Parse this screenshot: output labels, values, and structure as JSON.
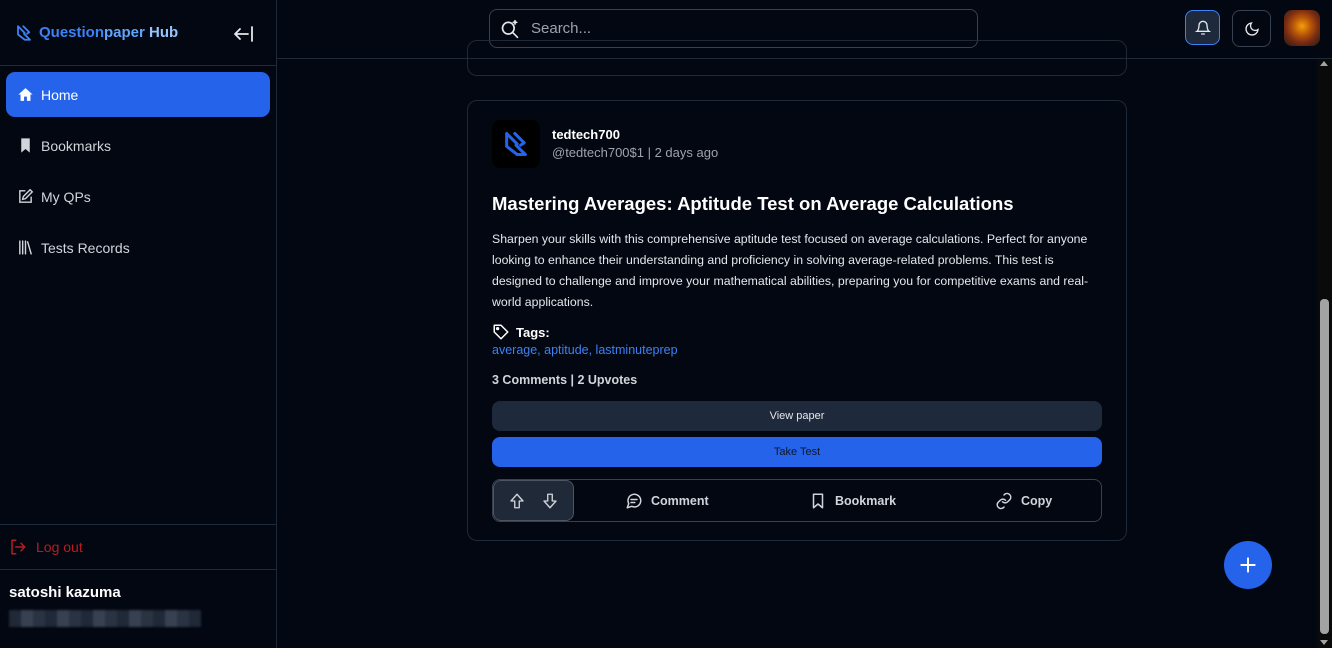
{
  "app": {
    "name_part1": "Question",
    "name_part2": "paper",
    "name_part3": " Hub"
  },
  "sidebar": {
    "items": [
      {
        "label": "Home",
        "icon": "home-icon",
        "active": true
      },
      {
        "label": "Bookmarks",
        "icon": "bookmark-icon"
      },
      {
        "label": "My QPs",
        "icon": "edit-icon"
      },
      {
        "label": "Tests Records",
        "icon": "library-icon"
      }
    ],
    "logout_label": "Log out",
    "user_name": "satoshi kazuma"
  },
  "search": {
    "placeholder": "Search..."
  },
  "post": {
    "author": "tedtech700",
    "handle_time": "@tedtech700$1 | 2 days ago",
    "title": "Mastering Averages: Aptitude Test on Average Calculations",
    "description": "Sharpen your skills with this comprehensive aptitude test focused on average calculations. Perfect for anyone looking to enhance their understanding and proficiency in solving average-related problems. This test is designed to challenge and improve your mathematical abilities, preparing you for competitive exams and real-world applications.",
    "tags_label": "Tags:",
    "tags": "average, aptitude, lastminuteprep",
    "stats": "3 Comments | 2 Upvotes",
    "view_label": "View paper",
    "test_label": "Take Test",
    "comment_label": "Comment",
    "bookmark_label": "Bookmark",
    "copy_label": "Copy"
  },
  "colors": {
    "accent": "#2563eb",
    "background": "#030712",
    "logout": "#b91c1c"
  }
}
